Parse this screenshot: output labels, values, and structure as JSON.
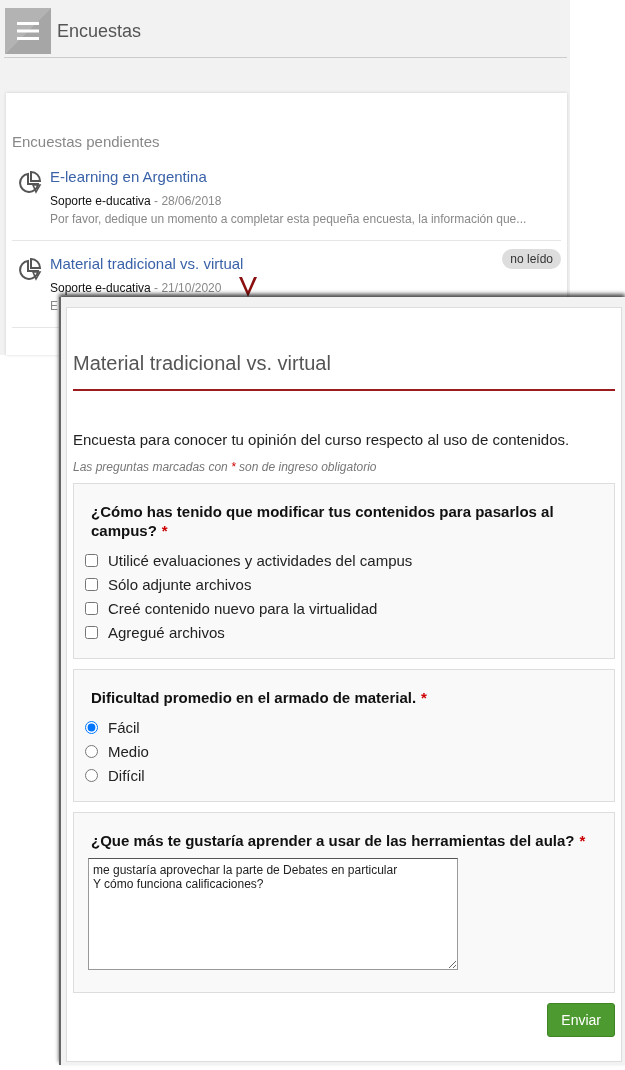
{
  "header": {
    "title": "Encuestas"
  },
  "pending": {
    "heading": "Encuestas pendientes",
    "items": [
      {
        "title": "E-learning en Argentina",
        "author": "Soporte e-ducativa",
        "separator": "-",
        "date": "28/06/2018",
        "description": "Por favor, dedique un momento a completar esta pequeña encuesta, la información que..."
      },
      {
        "title": "Material tradicional vs. virtual",
        "author": "Soporte e-ducativa",
        "separator": "-",
        "date": "21/10/2020",
        "description": "E",
        "badge": "no leído"
      }
    ]
  },
  "form": {
    "title": "Material tradicional vs. virtual",
    "description": "Encuesta para conocer tu opinión del curso respecto al uso de contenidos.",
    "note_prefix": "Las preguntas marcadas con",
    "required_mark": "*",
    "note_suffix": "son de ingreso obligatorio",
    "questions": [
      {
        "kind": "checkbox",
        "text": "¿Cómo has tenido que modificar tus contenidos para pasarlos al campus?",
        "required": true,
        "options": [
          {
            "label": "Utilicé evaluaciones y actividades del campus",
            "checked": false
          },
          {
            "label": "Sólo adjunte archivos",
            "checked": false
          },
          {
            "label": "Creé contenido nuevo para la virtualidad",
            "checked": false
          },
          {
            "label": "Agregué archivos",
            "checked": false
          }
        ]
      },
      {
        "kind": "radio",
        "text": "Dificultad promedio en el armado de material.",
        "required": true,
        "options": [
          {
            "label": "Fácil",
            "selected": true
          },
          {
            "label": "Medio",
            "selected": false
          },
          {
            "label": "Difícil",
            "selected": false
          }
        ]
      },
      {
        "kind": "textarea",
        "text": "¿Que más te gustaría aprender a usar de las herramientas del aula?",
        "required": true,
        "value": "me gustaría aprovechar la parte de Debates en particular\nY cómo funciona calificaciones?"
      }
    ],
    "submit": "Enviar"
  }
}
